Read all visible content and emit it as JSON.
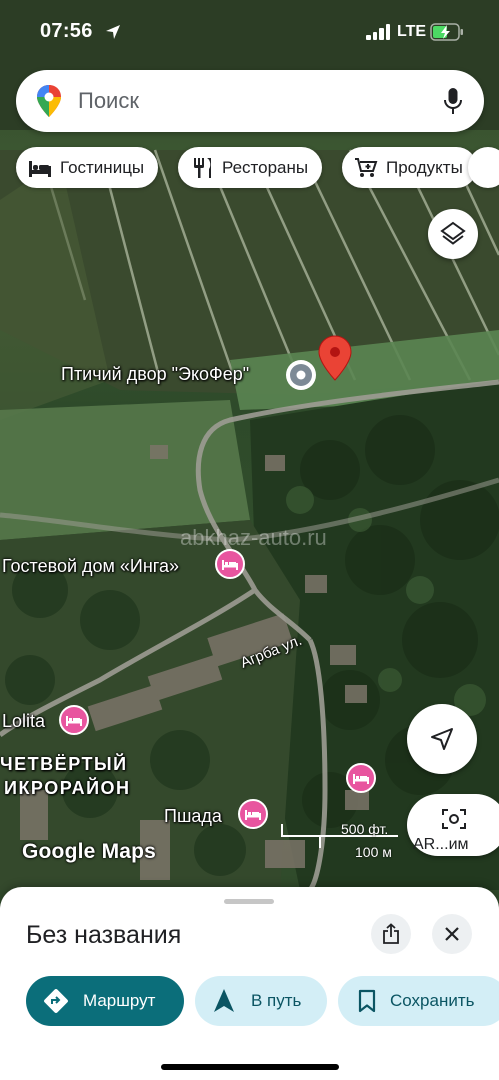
{
  "status_bar": {
    "time": "07:56",
    "network": "LTE"
  },
  "search": {
    "placeholder": "Поиск",
    "left_icon": "google-maps-pin-icon",
    "right_icon": "mic-icon"
  },
  "chips": [
    {
      "label": "Гостиницы",
      "icon": "bed-icon"
    },
    {
      "label": "Рестораны",
      "icon": "fork-knife-icon"
    },
    {
      "label": "Продукты",
      "icon": "cart-icon"
    }
  ],
  "map": {
    "labels": {
      "poi": "Птичий двор \"ЭкоФер\"",
      "guest_house": "Гостевой дом «Инга»",
      "street": "Агрба ул.",
      "lolita": "Lolita",
      "district_line1": "ЧЕТВЁРТЫЙ",
      "district_line2": "ИКРОРАЙОН",
      "pshada": "Пшада"
    },
    "watermark": "abkhaz-auto.ru",
    "scale": {
      "imperial": "500 фт.",
      "metric": "100 м"
    },
    "attribution": "Google Maps",
    "ar_button_label": "AR...им",
    "colors": {
      "pin_red": "#ea4335",
      "hotel_pink": "#e8559f"
    }
  },
  "sheet": {
    "title": "Без названия",
    "actions": [
      {
        "label": "Маршрут",
        "icon": "directions-icon"
      },
      {
        "label": "В путь",
        "icon": "navigation-arrow-icon"
      },
      {
        "label": "Сохранить",
        "icon": "bookmark-icon"
      }
    ],
    "colors": {
      "primary": "#0b6e7a",
      "secondary_bg": "#d3eef6"
    }
  }
}
